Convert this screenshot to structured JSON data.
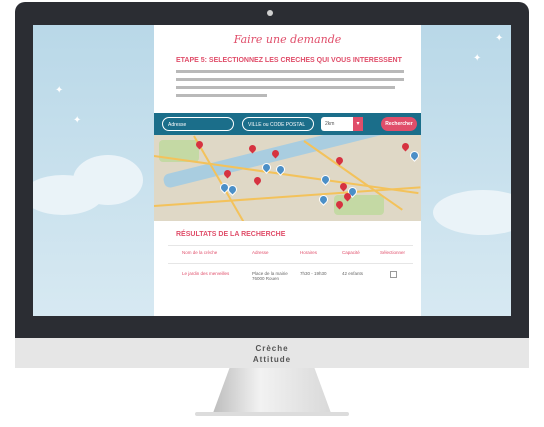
{
  "page": {
    "title": "Faire une demande",
    "step_heading": "ETAPE 5: SELECTIONNEZ LES CRECHES QUI VOUS INTERESSENT"
  },
  "search": {
    "address_placeholder": "Adresse",
    "city_placeholder": "VILLE ou CODE POSTAL",
    "distance_value": "2km",
    "search_button": "Rechercher"
  },
  "results": {
    "heading": "RÉSULTATS DE LA RECHERCHE",
    "columns": [
      "Nom de la crèche",
      "Adresse",
      "Horaires",
      "Capacité",
      "Sélectionner"
    ],
    "rows": [
      {
        "name": "Le jardin des merveilles",
        "address": "Place de la mairie 76000 Rouen",
        "hours": "7h30 - 19h30",
        "capacity": "42 enfants",
        "selected": false
      }
    ]
  },
  "brand": {
    "line1": "Crèche",
    "line2": "Attitude"
  },
  "colors": {
    "accent": "#e04e6a",
    "search_bar": "#1b6e8a",
    "bezel": "#2b2d33"
  }
}
